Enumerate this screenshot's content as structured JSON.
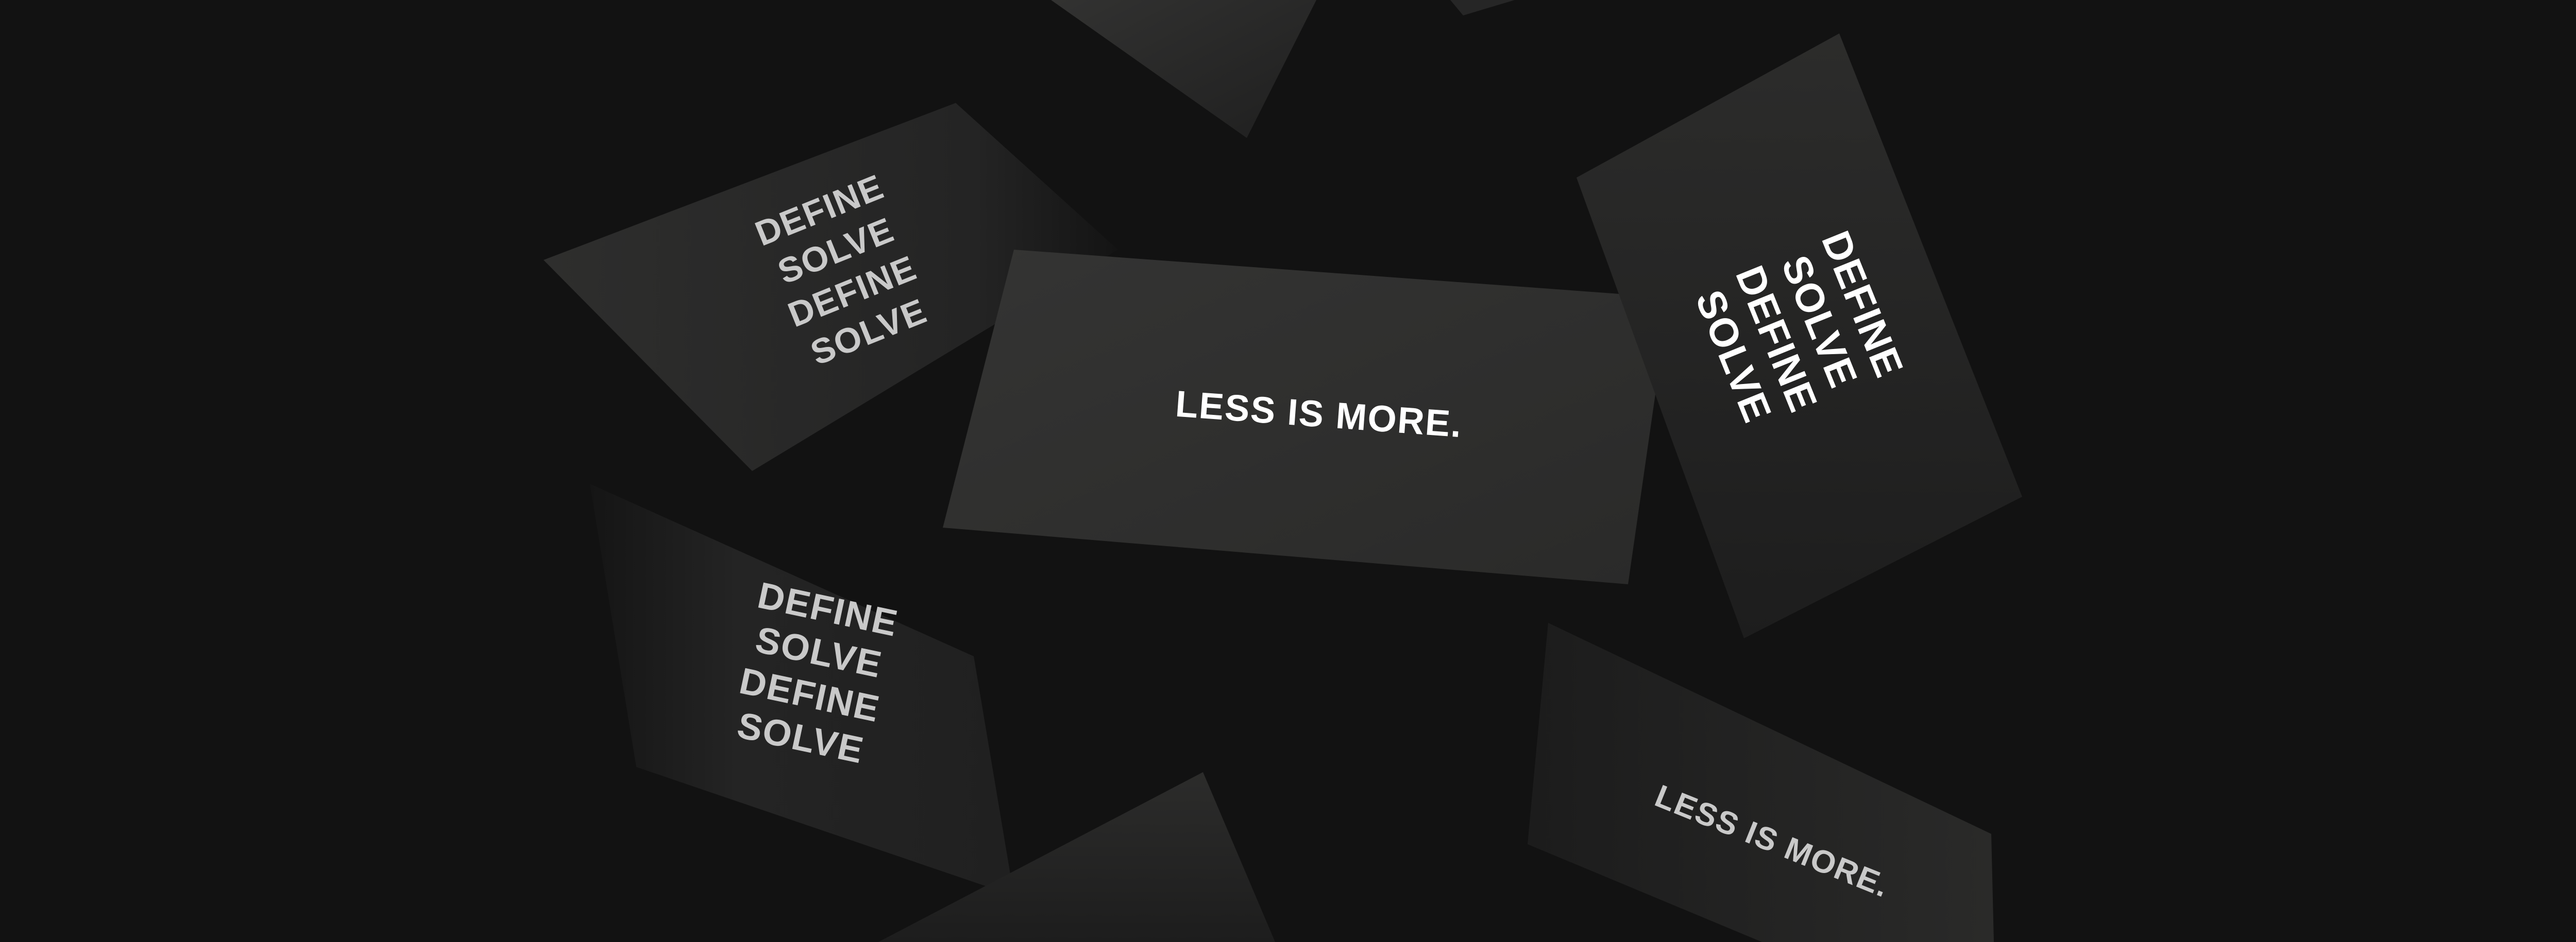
{
  "scene": {
    "background_color": "#121212",
    "card_color": "#2a2a29",
    "text_color_bright": "#ffffff",
    "text_color_muted": "#c9c9c9"
  },
  "cards": [
    {
      "id": "card-top-left",
      "lines": []
    },
    {
      "id": "card-top-sliver",
      "lines": []
    },
    {
      "id": "card-define-solve-upper-left",
      "lines": [
        "DEFINE",
        "SOLVE",
        "DEFINE",
        "SOLVE"
      ]
    },
    {
      "id": "card-less-is-more-center",
      "lines": [
        "LESS IS MORE."
      ]
    },
    {
      "id": "card-define-solve-right",
      "lines": [
        "DEFINE",
        "SOLVE",
        "DEFINE",
        "SOLVE"
      ]
    },
    {
      "id": "card-define-solve-lower-left",
      "lines": [
        "DEFINE",
        "SOLVE",
        "DEFINE",
        "SOLVE"
      ]
    },
    {
      "id": "card-bottom-center",
      "lines": []
    },
    {
      "id": "card-less-is-more-lower-right",
      "lines": [
        "LESS IS MORE."
      ]
    }
  ]
}
